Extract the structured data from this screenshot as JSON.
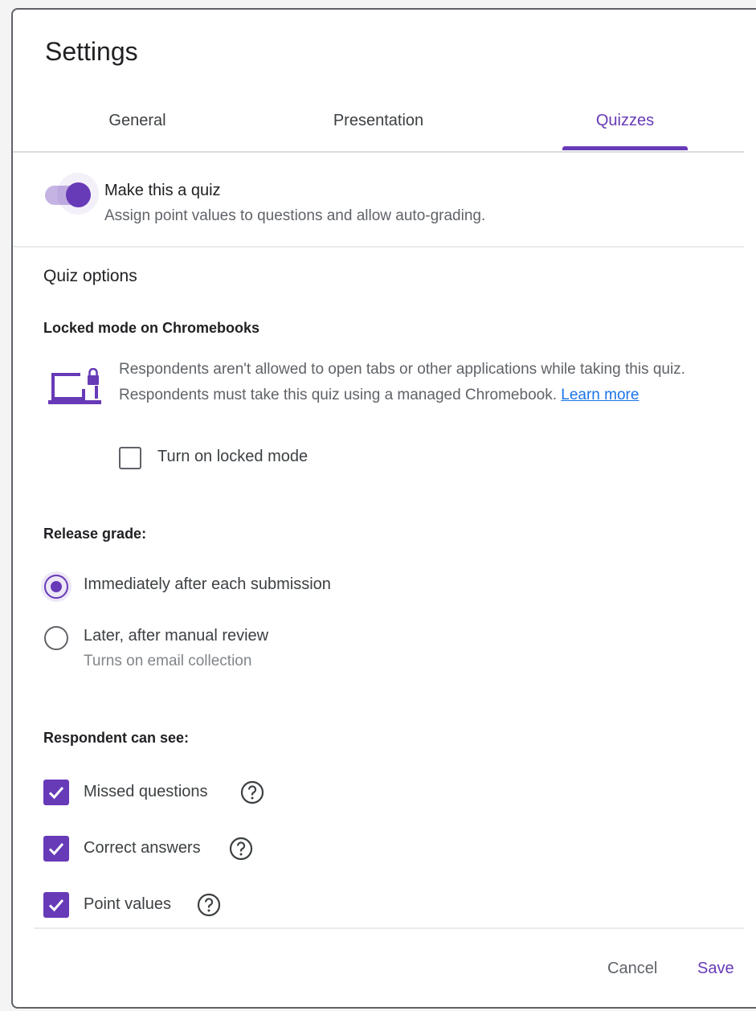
{
  "dialog": {
    "title": "Settings"
  },
  "tabs": [
    {
      "label": "General",
      "active": false
    },
    {
      "label": "Presentation",
      "active": false
    },
    {
      "label": "Quizzes",
      "active": true
    }
  ],
  "quiz_toggle": {
    "label": "Make this a quiz",
    "description": "Assign point values to questions and allow auto-grading.",
    "on": true
  },
  "quiz_options": {
    "title": "Quiz options",
    "locked_mode": {
      "heading": "Locked mode on Chromebooks",
      "icon": "laptop-lock-icon",
      "description": "Respondents aren't allowed to open tabs or other applications while taking this quiz. Respondents must take this quiz using a managed Chromebook.",
      "link_text": "Learn more",
      "checkbox_label": "Turn on locked mode",
      "checked": false
    },
    "release_grade": {
      "heading": "Release grade:",
      "options": [
        {
          "label": "Immediately after each submission",
          "selected": true
        },
        {
          "label": "Later, after manual review",
          "sublabel": "Turns on email collection",
          "selected": false
        }
      ]
    },
    "respondent_can_see": {
      "heading": "Respondent can see:",
      "items": [
        {
          "label": "Missed questions",
          "checked": true,
          "icon": "help-icon"
        },
        {
          "label": "Correct answers",
          "checked": true,
          "icon": "help-icon"
        },
        {
          "label": "Point values",
          "checked": true,
          "icon": "help-icon"
        }
      ]
    }
  },
  "footer": {
    "cancel_label": "Cancel",
    "save_label": "Save"
  },
  "colors": {
    "accent": "#673ab7",
    "link": "#1a73e8",
    "text_primary": "#202124",
    "text_secondary": "#5f6368"
  }
}
